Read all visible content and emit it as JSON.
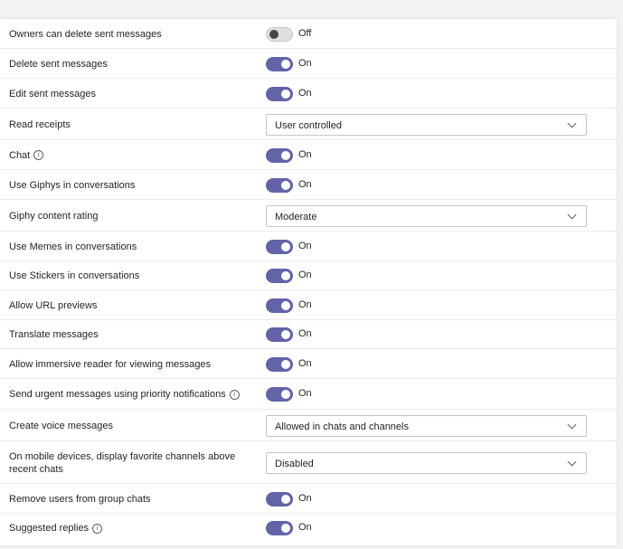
{
  "settings": [
    {
      "label": "Owners can delete sent messages",
      "type": "toggle",
      "state": "Off",
      "on": false
    },
    {
      "label": "Delete sent messages",
      "type": "toggle",
      "state": "On",
      "on": true
    },
    {
      "label": "Edit sent messages",
      "type": "toggle",
      "state": "On",
      "on": true
    },
    {
      "label": "Read receipts",
      "type": "select",
      "value": "User controlled"
    },
    {
      "label": "Chat",
      "type": "toggle",
      "state": "On",
      "on": true,
      "info": true
    },
    {
      "label": "Use Giphys in conversations",
      "type": "toggle",
      "state": "On",
      "on": true
    },
    {
      "label": "Giphy content rating",
      "type": "select",
      "value": "Moderate"
    },
    {
      "label": "Use Memes in conversations",
      "type": "toggle",
      "state": "On",
      "on": true
    },
    {
      "label": "Use Stickers in conversations",
      "type": "toggle",
      "state": "On",
      "on": true
    },
    {
      "label": "Allow URL previews",
      "type": "toggle",
      "state": "On",
      "on": true
    },
    {
      "label": "Translate messages",
      "type": "toggle",
      "state": "On",
      "on": true
    },
    {
      "label": "Allow immersive reader for viewing messages",
      "type": "toggle",
      "state": "On",
      "on": true
    },
    {
      "label": "Send urgent messages using priority notifications",
      "type": "toggle",
      "state": "On",
      "on": true,
      "info": true
    },
    {
      "label": "Create voice messages",
      "type": "select",
      "value": "Allowed in chats and channels"
    },
    {
      "label": "On mobile devices, display favorite channels above recent chats",
      "type": "select",
      "value": "Disabled"
    },
    {
      "label": "Remove users from group chats",
      "type": "toggle",
      "state": "On",
      "on": true
    },
    {
      "label": "Suggested replies",
      "type": "toggle",
      "state": "On",
      "on": true,
      "info": true
    }
  ],
  "info_glyph": "i",
  "colors": {
    "toggle_on": "#6264a7",
    "row_border": "#edebe9",
    "background": "#f3f2f1"
  },
  "icons": {
    "info": "info-icon",
    "dropdown": "chevron-down-icon"
  }
}
